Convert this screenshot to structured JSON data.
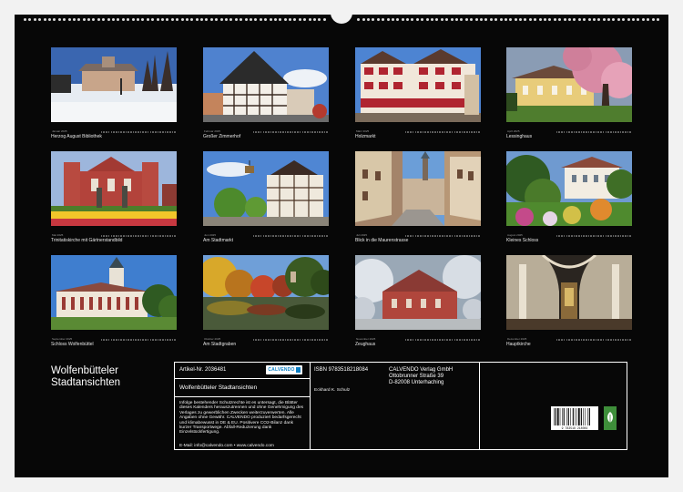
{
  "months": [
    {
      "caption": "Herzog August Bibliothek",
      "month_label": "Januar 2025"
    },
    {
      "caption": "Großer Zimmerhof",
      "month_label": "Februar 2025"
    },
    {
      "caption": "Holzmarkt",
      "month_label": "März 2025"
    },
    {
      "caption": "Lessinghaus",
      "month_label": "April 2025"
    },
    {
      "caption": "Trinitatiskirche mit Gärtnerstandbild",
      "month_label": "Mai 2025"
    },
    {
      "caption": "Am Stadtmarkt",
      "month_label": "Juni 2025"
    },
    {
      "caption": "Blick in die Maurenstrasse",
      "month_label": "Juli 2025"
    },
    {
      "caption": "Kleines Schloss",
      "month_label": "August 2025"
    },
    {
      "caption": "Schloss Wolfenbüttel",
      "month_label": "September 2025"
    },
    {
      "caption": "Am Stadtgraben",
      "month_label": "Oktober 2025"
    },
    {
      "caption": "Zeughaus",
      "month_label": "November 2025"
    },
    {
      "caption": "Hauptkirche",
      "month_label": "Dezember 2025"
    }
  ],
  "title": {
    "line1": "Wolfenbütteler",
    "line2": "Stadtansichten"
  },
  "info": {
    "article_no": "Artikel-Nr. 2036481",
    "product_title": "Wolfenbütteler Stadtansichten",
    "logo_text": "CALVENDO",
    "isbn": "ISBN 9783518218084",
    "author": "Eckhard K. Schulz",
    "publisher_name": "CALVENDO Verlag GmbH",
    "publisher_street": "Ottobrunner Straße 39",
    "publisher_city": "D-82008 Unterhaching",
    "legal_text": "Infolge bestehender Schutzrechte ist es untersagt, die Blätter dieses Kalenders herauszutrennen und ohne Genehmigung des Verlages zu gewerblichen Zwecken weiterzuverwerten. Alle Angaben ohne Gewähr. CALVENDO produziert bedarfsgerecht und klimabewusst in DE & EU. Positivere CO2-Bilanz dank kurzer Transportwege. Abfall-Reduzierung dank Einzelstückfertigung.",
    "contact": "E-Mail: info@calvendo.com • www.calvendo.com",
    "barcode_digits": "9 783518 218084"
  },
  "colors": {
    "sheet": "#070707",
    "text": "#ffffff",
    "brand": "#0a7fc4",
    "eco": "#3e8e3a"
  }
}
